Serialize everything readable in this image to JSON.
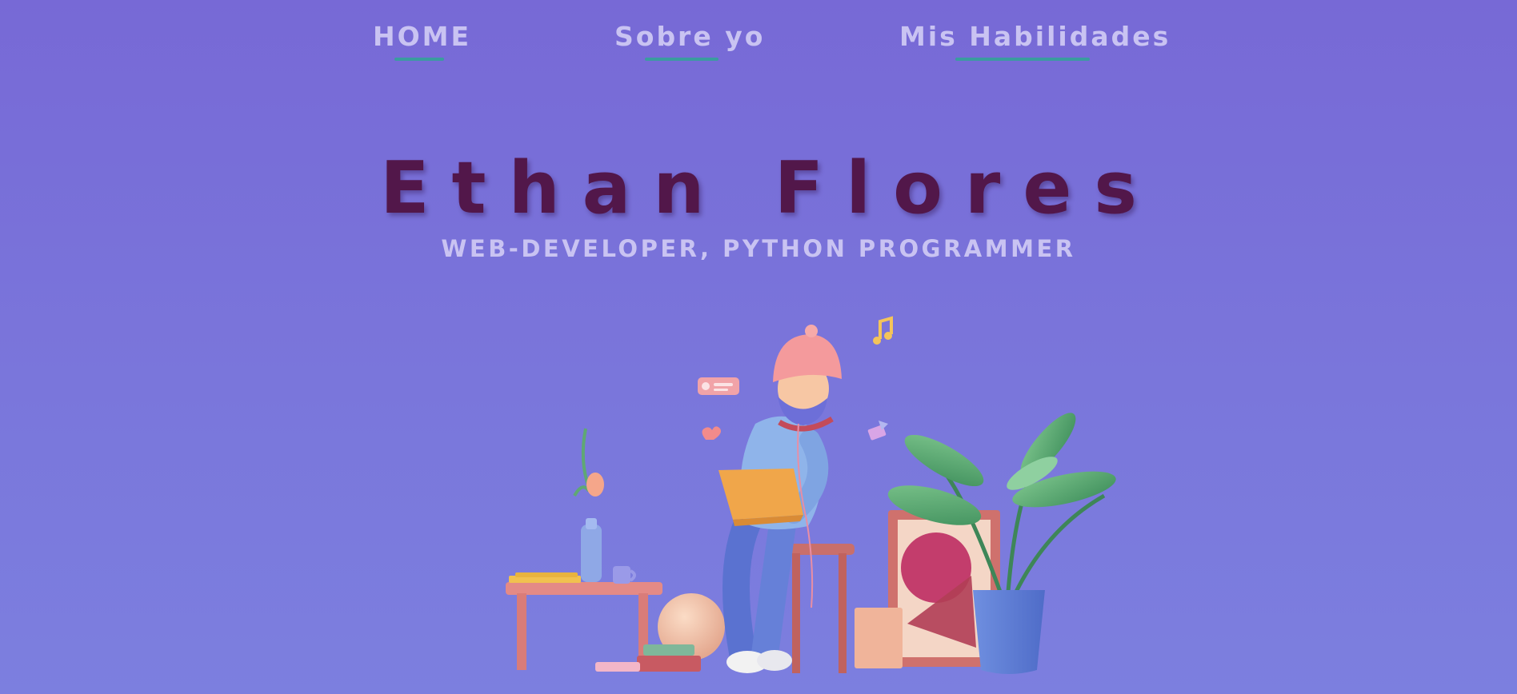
{
  "nav": {
    "items": [
      {
        "label": "HOME"
      },
      {
        "label": "Sobre yo"
      },
      {
        "label": "Mis Habilidades"
      }
    ],
    "underline_color": "#3a9c9f",
    "text_color": "#c9c3f2"
  },
  "hero": {
    "name": "Ethan Flores",
    "role": "WEB-DEVELOPER, PYTHON PROGRAMMER",
    "name_color": "#52174a"
  },
  "illustration": {
    "subject": "developer-with-laptop",
    "icons": [
      "music-note-icon",
      "chat-bubble-icon",
      "heart-icon",
      "envelope-icon"
    ]
  },
  "colors": {
    "background": "#7769d6",
    "accent": "#3a9c9f"
  }
}
